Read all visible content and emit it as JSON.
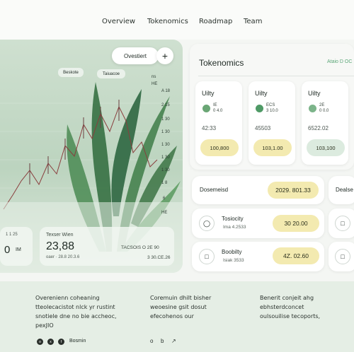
{
  "nav": {
    "overview": "Overview",
    "tokenomics": "Tokenomics",
    "roadmap": "Roadmap",
    "team": "Team"
  },
  "hero": {
    "pill_label": "Ovestiert",
    "plus": "+",
    "tag_top": "Beskote",
    "tag_mid": "Taiuacoe",
    "side_labels": [
      "ns",
      "HE",
      "A 18",
      "2 15",
      "1 30",
      "1 30",
      "1 30",
      "1 30",
      "1 30",
      "1 8",
      "6",
      "HE"
    ],
    "stat_left_label": "1 1 25",
    "stat_left_value": "0",
    "stat_left_unit": "IM",
    "stat_main_label": "Texser Wien",
    "stat_main_value": "23,88",
    "stat_main_sub": "oaer · 28.8 20.3.6",
    "stat_right_top": "TACSOIS O 2E 90",
    "stat_right_bottom": "3 30.CE.26"
  },
  "tokenomics": {
    "title": "Tokenomics",
    "link": "Ataio D OC",
    "cards": [
      {
        "name": "Uilty",
        "small1": "IE",
        "small2": "0 4.0",
        "value": "42:33",
        "button": "100,800",
        "btn_color": "#f3eab0",
        "icon_color": "#6aa675"
      },
      {
        "name": "Uilty",
        "small1": "ECS",
        "small2": "3 10.0",
        "value": "45503",
        "button": "103,1.00",
        "btn_color": "#f3eab0",
        "icon_color": "#4f9a66"
      },
      {
        "name": "Uilty",
        "small1": "2E",
        "small2": "0 0.0",
        "value": "6522.02",
        "button": "103,100",
        "btn_color": "#dcebdf",
        "icon_color": "#7cb48a"
      }
    ]
  },
  "rows": {
    "r1": {
      "label": "Dosemeisd",
      "value": "2029. 801.33",
      "right": "Dealse"
    },
    "r2": {
      "title": "Tosiocity",
      "sub": "Ima 4.2533",
      "value": "30 20.00"
    },
    "r3": {
      "title": "Boobilty",
      "sub": "Isiak 3533",
      "value": "4Z. 02.60"
    }
  },
  "footer": {
    "col1": [
      "Overenienn coheaning",
      "tteolecacistot nlck yr rustint",
      "snotiele dne no bie accheoc,",
      "pexJIO"
    ],
    "col2": [
      "Coremuin dhilt bisher",
      "weoesine gsit dosut",
      "efecohenos our"
    ],
    "col3": [
      "Benerit conjeit ahg",
      "ebhsterdconcet",
      "oulsouilise tecoports,"
    ],
    "social_label": "Bosmin",
    "icons": [
      "o",
      "b",
      "↗"
    ]
  }
}
